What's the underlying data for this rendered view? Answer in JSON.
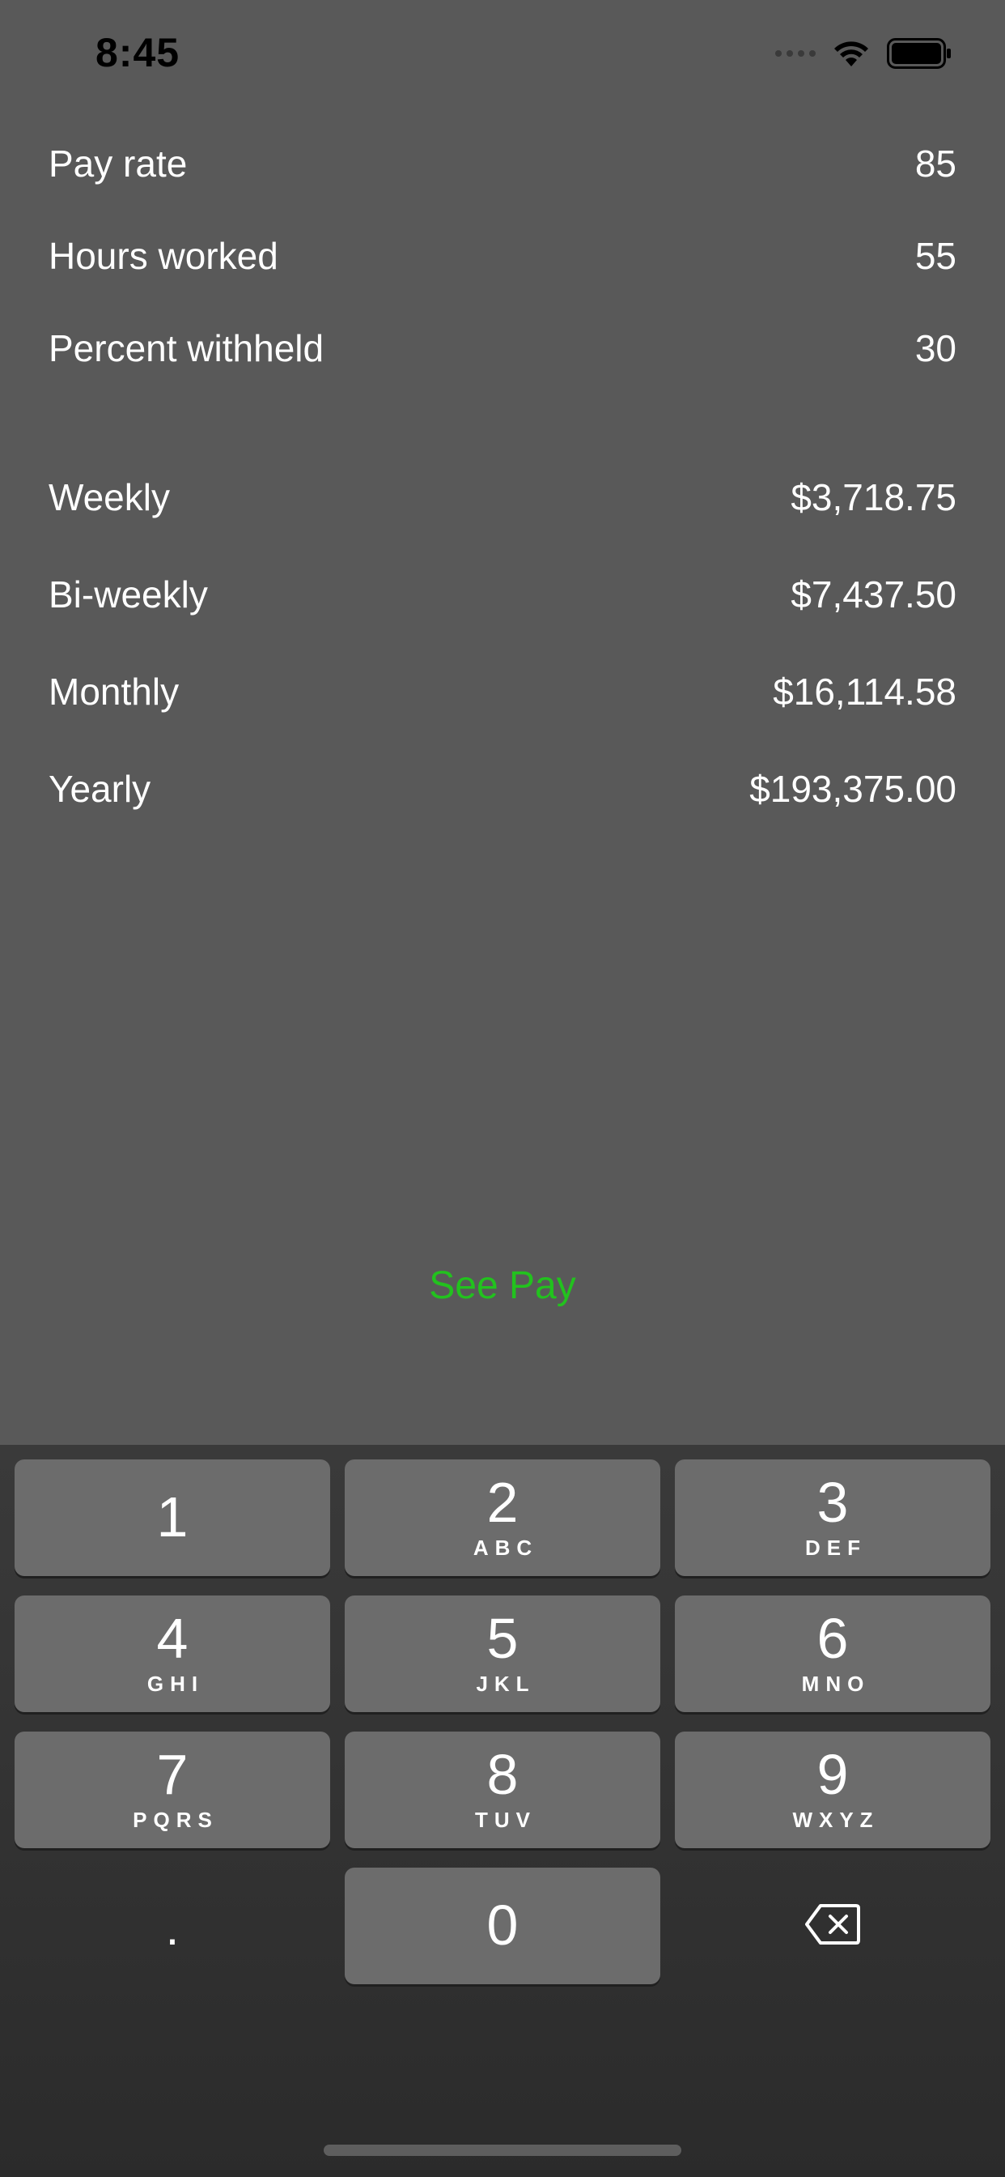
{
  "status_bar": {
    "time": "8:45"
  },
  "inputs": [
    {
      "label": "Pay rate",
      "value": "85"
    },
    {
      "label": "Hours worked",
      "value": "55"
    },
    {
      "label": "Percent withheld",
      "value": "30"
    }
  ],
  "results": [
    {
      "label": "Weekly",
      "value": "$3,718.75"
    },
    {
      "label": "Bi-weekly",
      "value": "$7,437.50"
    },
    {
      "label": "Monthly",
      "value": "$16,114.58"
    },
    {
      "label": "Yearly",
      "value": "$193,375.00"
    }
  ],
  "action": {
    "see_pay_label": "See Pay"
  },
  "keyboard": {
    "keys": [
      {
        "digit": "1",
        "letters": ""
      },
      {
        "digit": "2",
        "letters": "ABC"
      },
      {
        "digit": "3",
        "letters": "DEF"
      },
      {
        "digit": "4",
        "letters": "GHI"
      },
      {
        "digit": "5",
        "letters": "JKL"
      },
      {
        "digit": "6",
        "letters": "MNO"
      },
      {
        "digit": "7",
        "letters": "PQRS"
      },
      {
        "digit": "8",
        "letters": "TUV"
      },
      {
        "digit": "9",
        "letters": "WXYZ"
      },
      {
        "digit": "0",
        "letters": ""
      }
    ],
    "decimal": ".",
    "delete_icon": "backspace-icon"
  },
  "colors": {
    "background": "#595959",
    "accent": "#22c21e",
    "key": "#6c6c6c",
    "keyboard": "#2b2b2b"
  }
}
